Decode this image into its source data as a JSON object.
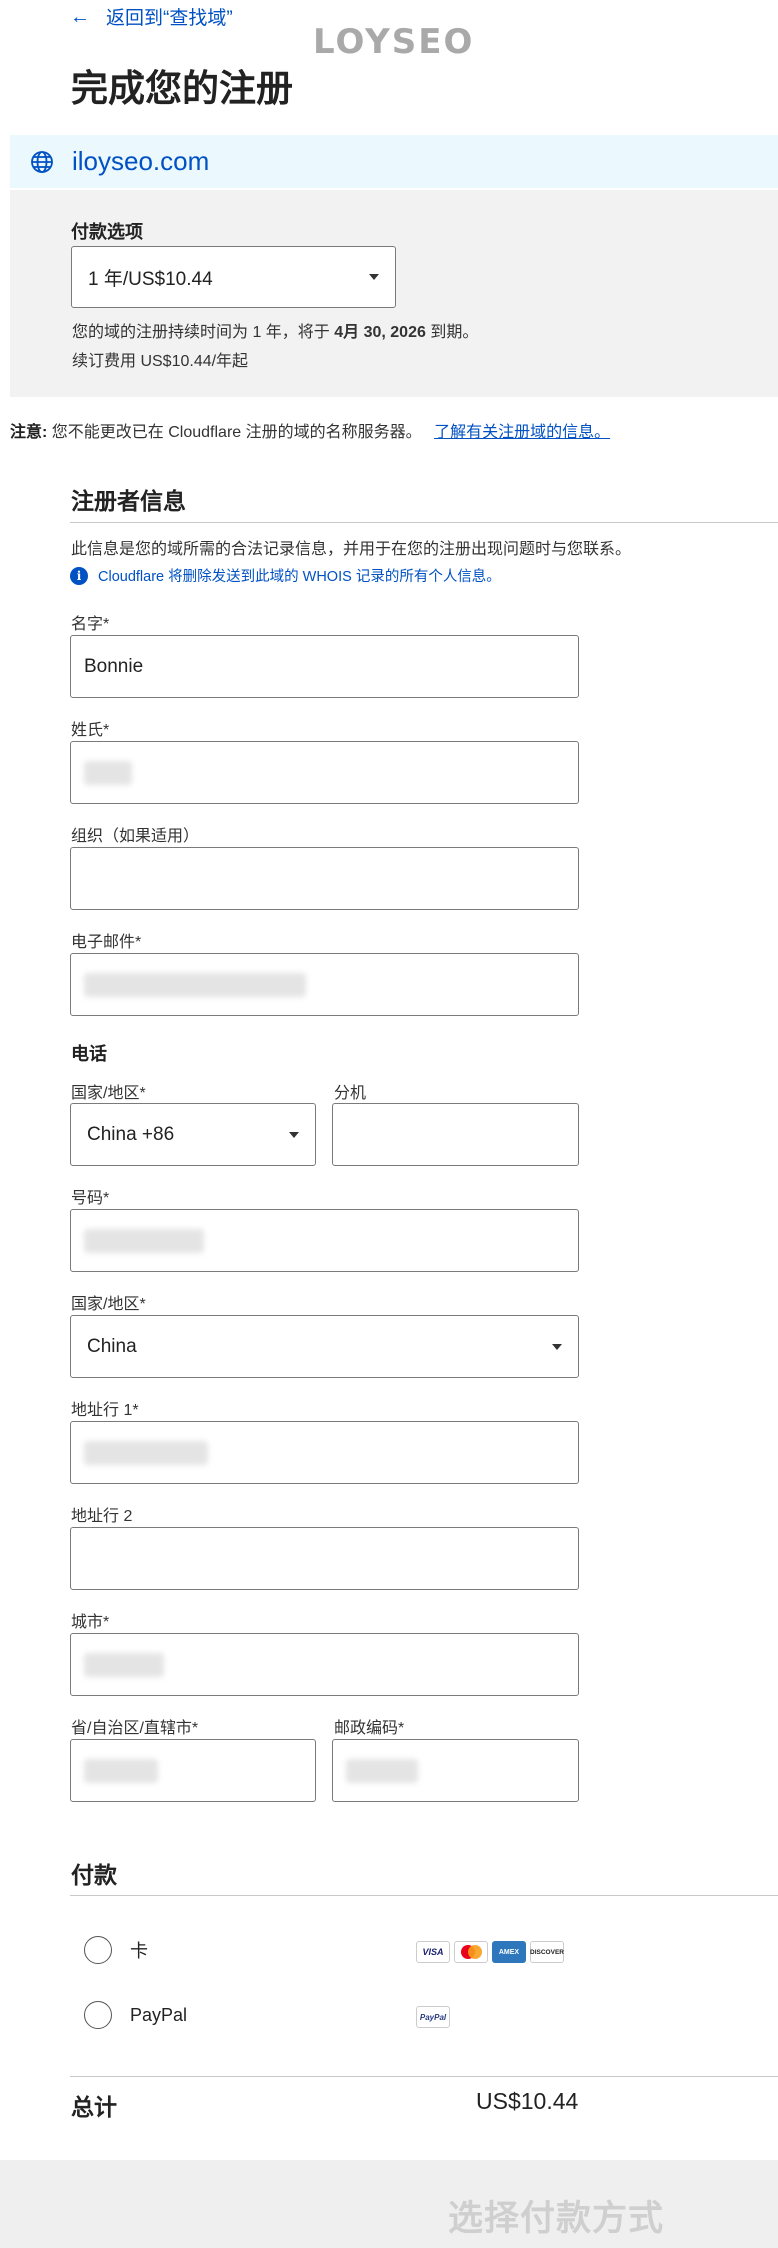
{
  "nav": {
    "back_label": "返回到“查找域”"
  },
  "watermark": {
    "logo_text": "LOYSEO"
  },
  "page": {
    "title": "完成您的注册"
  },
  "domain": {
    "name": "iloyseo.com"
  },
  "payment_options": {
    "heading": "付款选项",
    "selected": "1 年/US$10.44",
    "duration_text_before": "您的域的注册持续时间为 1 年，将于 ",
    "expiry_date": "4月 30, 2026",
    "duration_text_after": " 到期。",
    "renewal_text": "续订费用 US$10.44/年起"
  },
  "notice": {
    "label": "注意:",
    "text": "您不能更改已在 Cloudflare 注册的域的名称服务器。",
    "link": "了解有关注册域的信息。"
  },
  "registrant": {
    "heading": "注册者信息",
    "description": "此信息是您的域所需的合法记录信息，并用于在您的注册出现问题时与您联系。",
    "whois_info": "Cloudflare 将删除发送到此域的 WHOIS 记录的所有个人信息。",
    "first_name_label": "名字*",
    "first_name_value": "Bonnie",
    "last_name_label": "姓氏*",
    "org_label": "组织（如果适用）",
    "email_label": "电子邮件*"
  },
  "phone": {
    "heading": "电话",
    "country_label": "国家/地区*",
    "country_value": "China +86",
    "extension_label": "分机",
    "number_label": "号码*"
  },
  "address": {
    "country_label": "国家/地区*",
    "country_value": "China",
    "line1_label": "地址行 1*",
    "line2_label": "地址行 2",
    "city_label": "城市*",
    "province_label": "省/自治区/直辖市*",
    "postal_label": "邮政编码*"
  },
  "payment": {
    "heading": "付款",
    "card_label": "卡",
    "paypal_label": "PayPal",
    "card_brands": [
      "VISA",
      "mastercard",
      "AMEX",
      "DISCOVER"
    ],
    "paypal_brand": "PayPal"
  },
  "total": {
    "label": "总计",
    "value": "US$10.44"
  },
  "footer": {
    "button_label": "选择付款方式"
  },
  "colors": {
    "accent": "#0051c3",
    "info_bg": "#ebf8fe",
    "panel_bg": "#f2f2f2"
  }
}
